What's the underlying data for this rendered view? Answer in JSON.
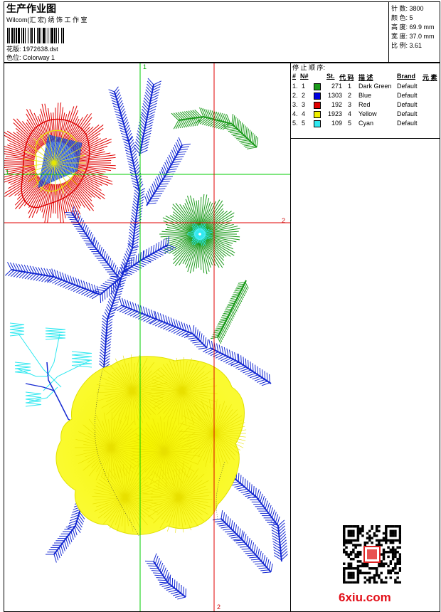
{
  "header": {
    "title": "生产作业图",
    "company": "Wilcom(汇 宏) 绣 饰 工 作 室",
    "file_label": "花版:",
    "file_name": "1972638.dst",
    "colorway_label": "色位:",
    "colorway_name": "Colorway 1"
  },
  "stats": {
    "stitches_label": "针 数:",
    "stitches": "3800",
    "colors_label": "颜 色:",
    "colors": "5",
    "height_label": "高 度:",
    "height": "69.9 mm",
    "width_label": "宽 度:",
    "width": "37.0 mm",
    "scale_label": "比 例:",
    "scale": "3.61"
  },
  "stop_sequence": {
    "title": "停 止 顺 序:",
    "columns": [
      "#",
      "N#",
      "St.",
      "代 码",
      "描 述",
      "Brand",
      "元 素"
    ],
    "rows": [
      {
        "num": "1.",
        "n": "1",
        "color": "#1a9a1a",
        "stitches": "271",
        "code": "1",
        "desc": "Dark Green",
        "brand": "Default"
      },
      {
        "num": "2.",
        "n": "2",
        "color": "#0000e0",
        "stitches": "1303",
        "code": "2",
        "desc": "Blue",
        "brand": "Default"
      },
      {
        "num": "3.",
        "n": "3",
        "color": "#e00000",
        "stitches": "192",
        "code": "3",
        "desc": "Red",
        "brand": "Default"
      },
      {
        "num": "4.",
        "n": "4",
        "color": "#f0f000",
        "stitches": "1923",
        "code": "4",
        "desc": "Yellow",
        "brand": "Default"
      },
      {
        "num": "5.",
        "n": "5",
        "color": "#30e8f0",
        "stitches": "109",
        "code": "5",
        "desc": "Cyan",
        "brand": "Default"
      }
    ]
  },
  "guides": {
    "green_label": "1",
    "red_label": "2"
  },
  "watermark": {
    "text": "6xiu",
    "dot": ".",
    "tld": "com"
  },
  "colors": {
    "green_guide": "#00cc00",
    "red_guide": "#e00000",
    "watermark": "#e3101a"
  }
}
